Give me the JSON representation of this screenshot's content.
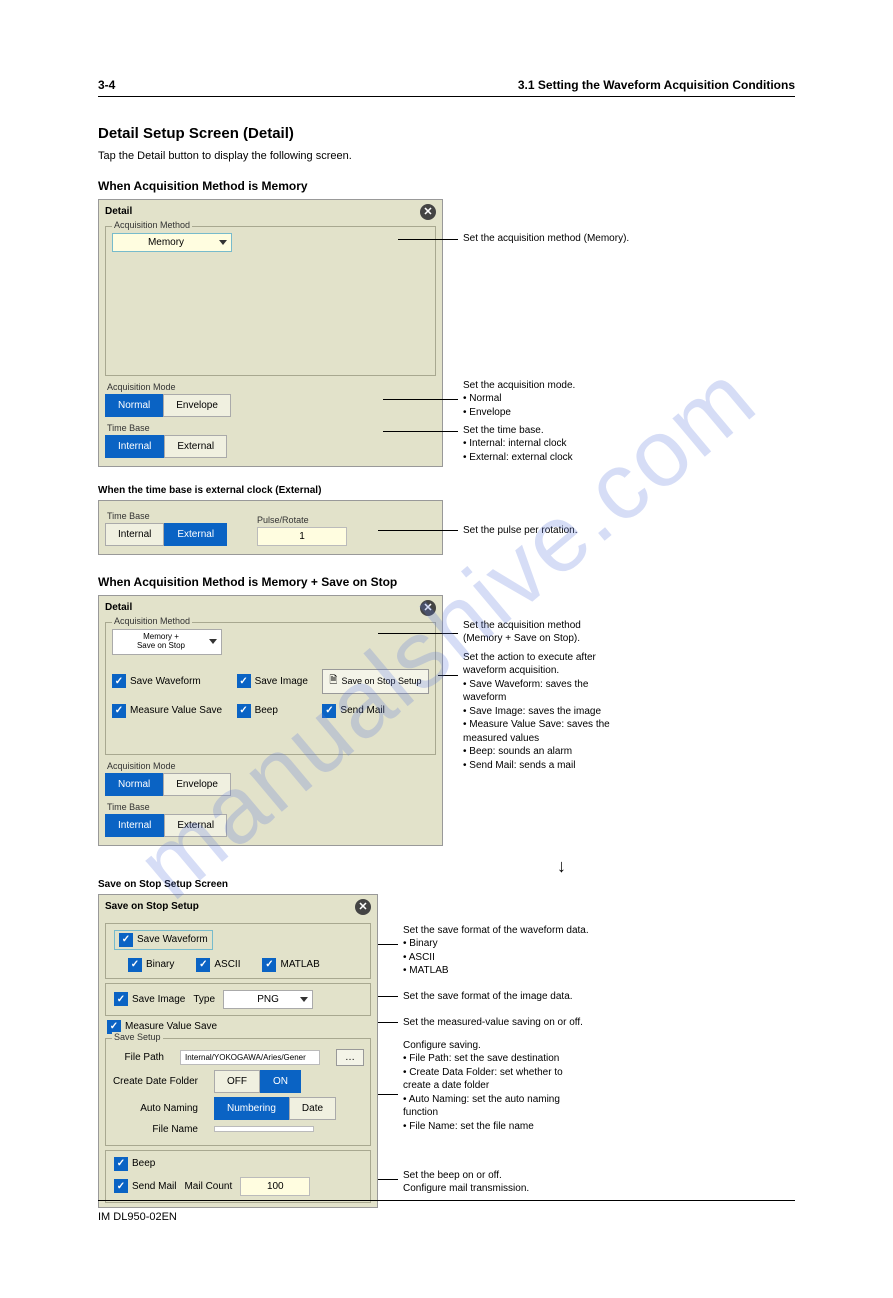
{
  "header": {
    "left": "3.1  Setting the Waveform Acquisition Conditions",
    "right": "3-4"
  },
  "section_title": "Detail Setup Screen (Detail)",
  "intro": "Tap the Detail button to display the following screen.",
  "watermark": "manualshive.com",
  "sub1": "When Acquisition Method is Memory",
  "panel1": {
    "title": "Detail",
    "legend_acq_method": "Acquisition Method",
    "select_memory": "Memory",
    "label_acq_mode": "Acquisition Mode",
    "btn_normal": "Normal",
    "btn_envelope": "Envelope",
    "label_time_base": "Time Base",
    "btn_internal": "Internal",
    "btn_external": "External"
  },
  "annot1": {
    "acq_method": "Set the acquisition method (Memory).",
    "acq_mode": "Set the acquisition mode.\n• Normal\n• Envelope",
    "time_base": "Set the time base.\n• Internal: internal clock\n• External: external clock"
  },
  "ext_clock_title": "When the time base is external clock (External)",
  "panel_ext": {
    "label_time_base": "Time Base",
    "btn_internal": "Internal",
    "btn_external": "External",
    "label_pulse": "Pulse/Rotate",
    "pulse_val": "1"
  },
  "annot_ext": "Set the pulse per rotation.",
  "sub2": "When Acquisition Method is Memory + Save on Stop",
  "panel2": {
    "title": "Detail",
    "legend": "Acquisition Method",
    "select_text_line1": "Memory +",
    "select_text_line2": "Save on Stop",
    "chk_wave": "Save Waveform",
    "chk_image": "Save Image",
    "chk_measure": "Measure Value Save",
    "chk_beep": "Beep",
    "chk_mail": "Send Mail",
    "setup_btn": "Save on Stop Setup",
    "label_acq_mode": "Acquisition Mode",
    "btn_normal": "Normal",
    "btn_envelope": "Envelope",
    "label_time_base": "Time Base",
    "btn_internal": "Internal",
    "btn_external": "External"
  },
  "annot2": {
    "acq_method": "Set the acquisition method\n(Memory + Save on Stop).",
    "actions": "Set the action to execute after\nwaveform acquisition.\n• Save Waveform: saves the\n  waveform\n• Save Image: saves the image\n• Measure Value Save: saves the\n  measured values\n• Beep: sounds an alarm\n• Send Mail: sends a mail"
  },
  "save_stop_title": "Save on Stop Setup Screen",
  "panel3": {
    "title": "Save on Stop Setup",
    "chk_wave": "Save Waveform",
    "chk_binary": "Binary",
    "chk_ascii": "ASCII",
    "chk_matlab": "MATLAB",
    "chk_image": "Save Image",
    "type_label": "Type",
    "type_val": "PNG",
    "chk_measure": "Measure Value Save",
    "save_setup_legend": "Save Setup",
    "file_path_label": "File Path",
    "file_path_val": "Internal/YOKOGAWA/Aries/Gener",
    "create_date_label": "Create Date Folder",
    "off": "OFF",
    "on": "ON",
    "auto_naming_label": "Auto Naming",
    "numbering": "Numbering",
    "date": "Date",
    "file_name_label": "File Name",
    "chk_beep": "Beep",
    "chk_mail": "Send Mail",
    "mail_count_label": "Mail Count",
    "mail_count_val": "100"
  },
  "annot3": {
    "wave": "Set the save format of the waveform data.\n• Binary\n• ASCII\n• MATLAB",
    "image": "Set the save format of the image data.",
    "measure": "Set the measured-value saving on or off.",
    "save_setup": "Configure saving.\n• File Path: set the save destination\n• Create Data Folder: set whether to\n  create a date folder\n• Auto Naming: set the auto naming\n  function\n• File Name: set the file name",
    "beep": "Set the beep on or off.\nConfigure mail transmission."
  },
  "footer": {
    "left": "IM DL950-02EN",
    "right": ""
  }
}
